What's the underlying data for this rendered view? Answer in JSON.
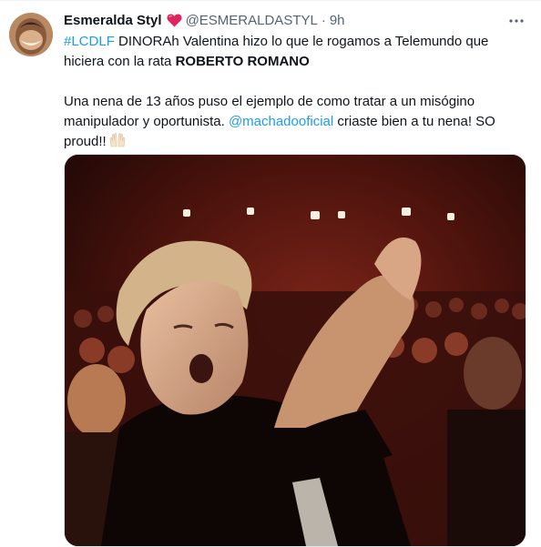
{
  "tweet": {
    "display_name": "Esmeralda Styl",
    "handle": "@ESMERALDASTYL",
    "separator": "·",
    "time": "9h",
    "hashtag": "#LCDLF",
    "line1_text": " DINORAh Valentina hizo lo que le rogamos a Telemundo que hiciera con la rata ",
    "line1_bold": "ROBERTO ROMANO",
    "para2_text": "Una nena de 13 años puso el ejemplo de como tratar a un misógino manipulador y oportunista. ",
    "mention": "@machadooficial",
    "para2_after": " criaste bien a tu nena! SO proud!!",
    "icons": {
      "heart": "heart-icon",
      "more": "more-options-icon",
      "hands": "raising-hands-icon"
    },
    "colors": {
      "link": "#1d9bf0",
      "heart": "#e0245e",
      "secondary": "#536471"
    }
  }
}
